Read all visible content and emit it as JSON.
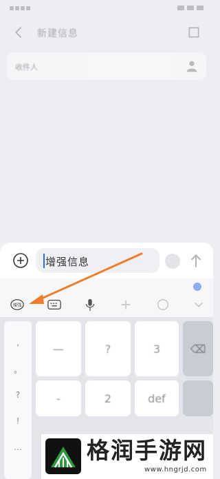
{
  "header": {
    "title": "新建信息"
  },
  "recipient": {
    "placeholder": "收件人"
  },
  "compose": {
    "message_text": "增强信息"
  },
  "toolbar": {
    "items": [
      {
        "name": "tool-enhanced",
        "label": "增强"
      },
      {
        "name": "tool-keyboard",
        "label": ""
      },
      {
        "name": "tool-voice",
        "label": ""
      },
      {
        "name": "tool-add",
        "label": ""
      },
      {
        "name": "tool-emoji",
        "label": ""
      },
      {
        "name": "tool-collapse",
        "label": ""
      }
    ]
  },
  "keyboard": {
    "side_symbols": [
      ",",
      "。",
      "?",
      "!",
      "…"
    ],
    "keys": [
      {
        "label": "—",
        "row": 0,
        "col": 0
      },
      {
        "label": "?",
        "row": 0,
        "col": 1
      },
      {
        "label": "3",
        "row": 0,
        "col": 2
      },
      {
        "label": "⌫",
        "row": 0,
        "col": 3
      },
      {
        "label": "-",
        "row": 1,
        "col": 0
      },
      {
        "label": "2",
        "row": 1,
        "col": 1
      },
      {
        "label": "def",
        "row": 1,
        "col": 2
      },
      {
        "label": "",
        "row": 1,
        "col": 3
      }
    ]
  },
  "watermark": {
    "text": "格润手游网",
    "url": "www.hngrjd.com"
  },
  "colors": {
    "accent": "#2a6cf0",
    "arrow": "#f07c2a"
  }
}
